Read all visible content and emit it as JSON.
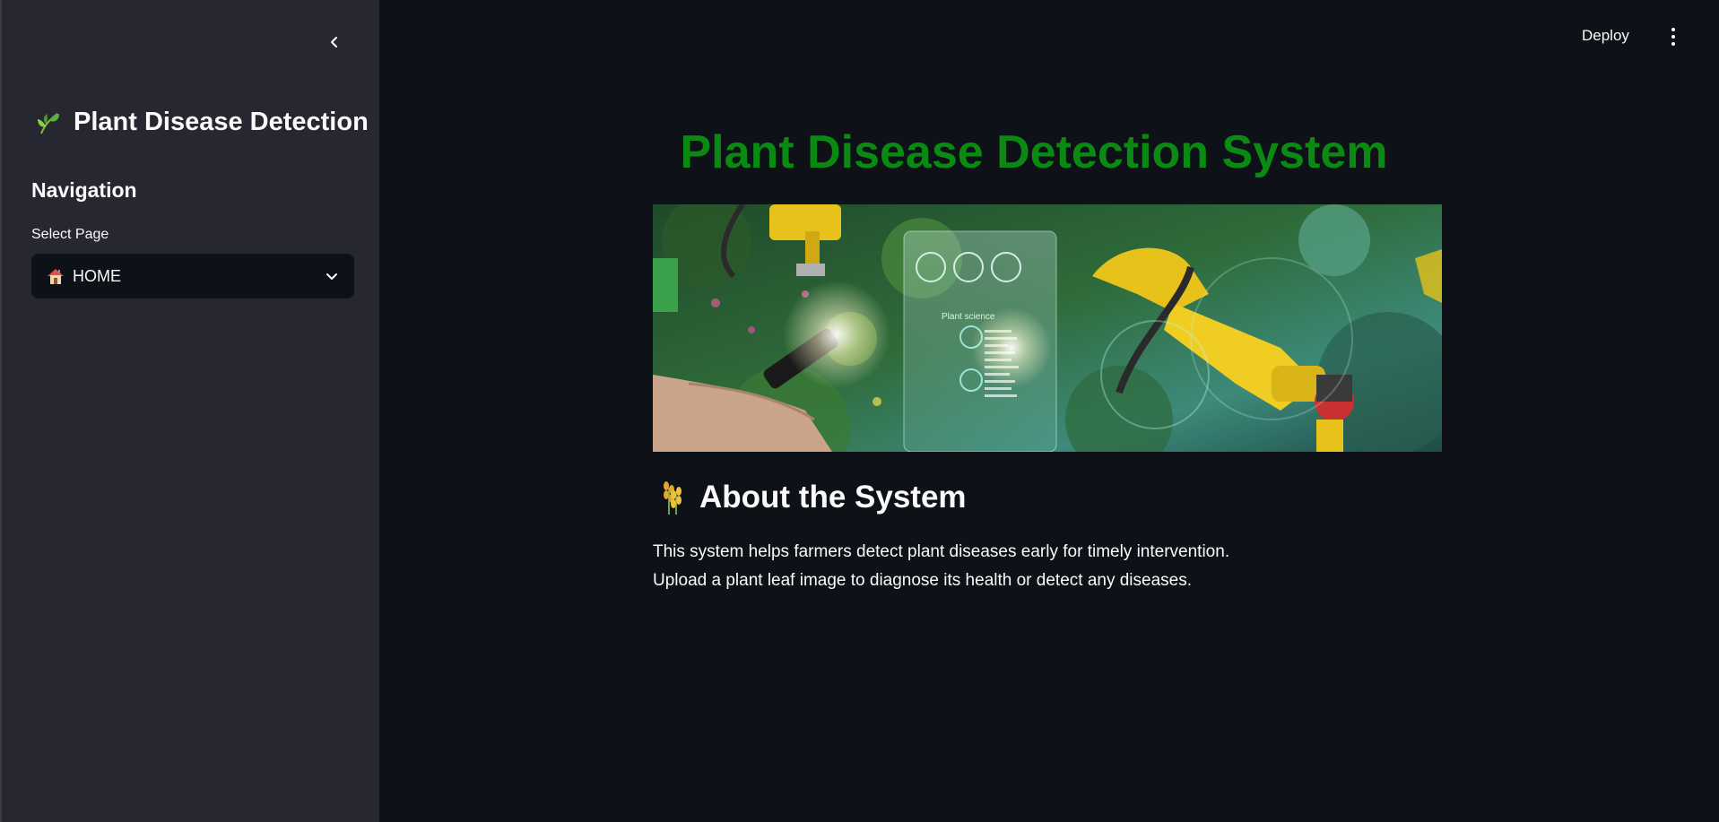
{
  "sidebar": {
    "title": "Plant Disease Detection",
    "title_icon": "leaf-icon",
    "nav_heading": "Navigation",
    "select_label": "Select Page",
    "select_value": "HOME",
    "select_icon": "house-icon"
  },
  "header": {
    "deploy_label": "Deploy"
  },
  "main": {
    "title": "Plant Disease Detection System",
    "about_heading": "About the System",
    "about_icon": "wheat-icon",
    "description_line1": "This system helps farmers detect plant diseases early for timely intervention.",
    "description_line2": "Upload a plant leaf image to diagnose its health or detect any diseases."
  },
  "colors": {
    "title_green": "#0a8a12",
    "sidebar_bg": "#262730",
    "app_bg": "#0e1117"
  }
}
